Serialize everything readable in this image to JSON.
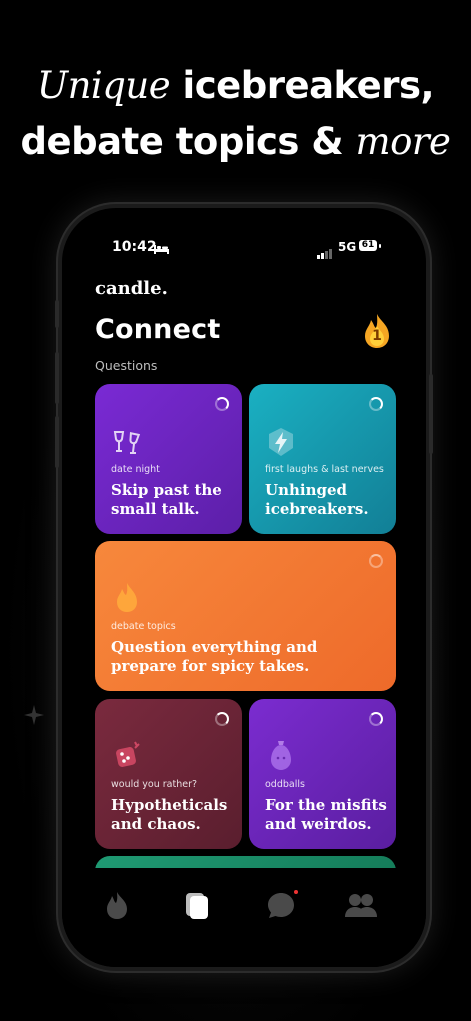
{
  "headline": {
    "line1_italic": "Unique",
    "line1_rest": " icebreakers,",
    "line2_rest": "debate topics & ",
    "line2_italic": "more"
  },
  "status_bar": {
    "time": "10:42",
    "network": "5G",
    "battery": "61"
  },
  "app": {
    "brand": "candle.",
    "title": "Connect",
    "streak_count": "1",
    "section_label": "Questions"
  },
  "cards": [
    {
      "category": "date night",
      "headline_l1": "Skip past the",
      "headline_l2": "small talk.",
      "icon": "wine-glasses-icon",
      "color": "#7a2ad4"
    },
    {
      "category": "first laughs & last nerves",
      "headline_l1": "Unhinged",
      "headline_l2": "icebreakers.",
      "icon": "lightning-icon",
      "color": "#1ab0c2"
    },
    {
      "category": "debate topics",
      "headline_l1": "Question everything and",
      "headline_l2": "prepare for spicy takes.",
      "icon": "flame-icon",
      "color": "#f7883c"
    },
    {
      "category": "would you rather?",
      "headline_l1": "Hypotheticals",
      "headline_l2": "and chaos.",
      "icon": "dice-icon",
      "color": "#7a2a3e"
    },
    {
      "category": "oddballs",
      "headline_l1": "For the misfits",
      "headline_l2": "and weirdos.",
      "icon": "eggplant-icon",
      "color": "#7b2cd0"
    }
  ],
  "tabs": [
    {
      "icon": "flame-tab-icon",
      "active": false
    },
    {
      "icon": "cards-tab-icon",
      "active": true
    },
    {
      "icon": "chat-tab-icon",
      "active": false,
      "notification": true
    },
    {
      "icon": "people-tab-icon",
      "active": false
    }
  ]
}
